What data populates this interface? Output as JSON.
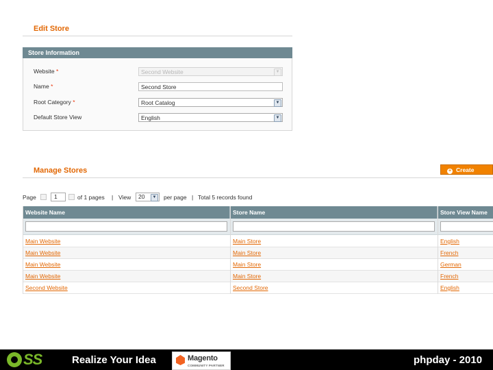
{
  "edit_store": {
    "title": "Edit Store",
    "fieldset_title": "Store Information",
    "fields": {
      "website": {
        "label": "Website",
        "required": "*",
        "value": "Second Website"
      },
      "name": {
        "label": "Name",
        "required": "*",
        "value": "Second Store"
      },
      "root_category": {
        "label": "Root Category",
        "required": "*",
        "value": "Root Catalog"
      },
      "default_store_view": {
        "label": "Default Store View",
        "value": "English"
      }
    }
  },
  "manage_stores": {
    "title": "Manage Stores",
    "create_button": "Create",
    "pager": {
      "page_label": "Page",
      "page_value": "1",
      "of_pages": "of 1 pages",
      "sep1": "|",
      "view_label": "View",
      "view_value": "20",
      "per_page": "per page",
      "sep2": "|",
      "total": "Total 5 records found"
    },
    "columns": [
      "Website Name",
      "Store Name",
      "Store View Name"
    ],
    "rows": [
      [
        "Main Website",
        "Main Store",
        "English"
      ],
      [
        "Main Website",
        "Main Store",
        "French"
      ],
      [
        "Main Website",
        "Main Store",
        "German"
      ],
      [
        "Main Website",
        "Main Store",
        "French"
      ],
      [
        "Second Website",
        "Second Store",
        "English"
      ]
    ]
  },
  "footer": {
    "logo": "OSS",
    "slogan": "Realize Your Idea",
    "partner_name": "Magento",
    "partner_sub": "COMMUNITY PARTNER",
    "event": "phpday - 2010"
  },
  "colors": {
    "accent": "#e26703",
    "header_bar": "#6f8992",
    "button": "#f18200",
    "oss_green": "#7ab829"
  }
}
